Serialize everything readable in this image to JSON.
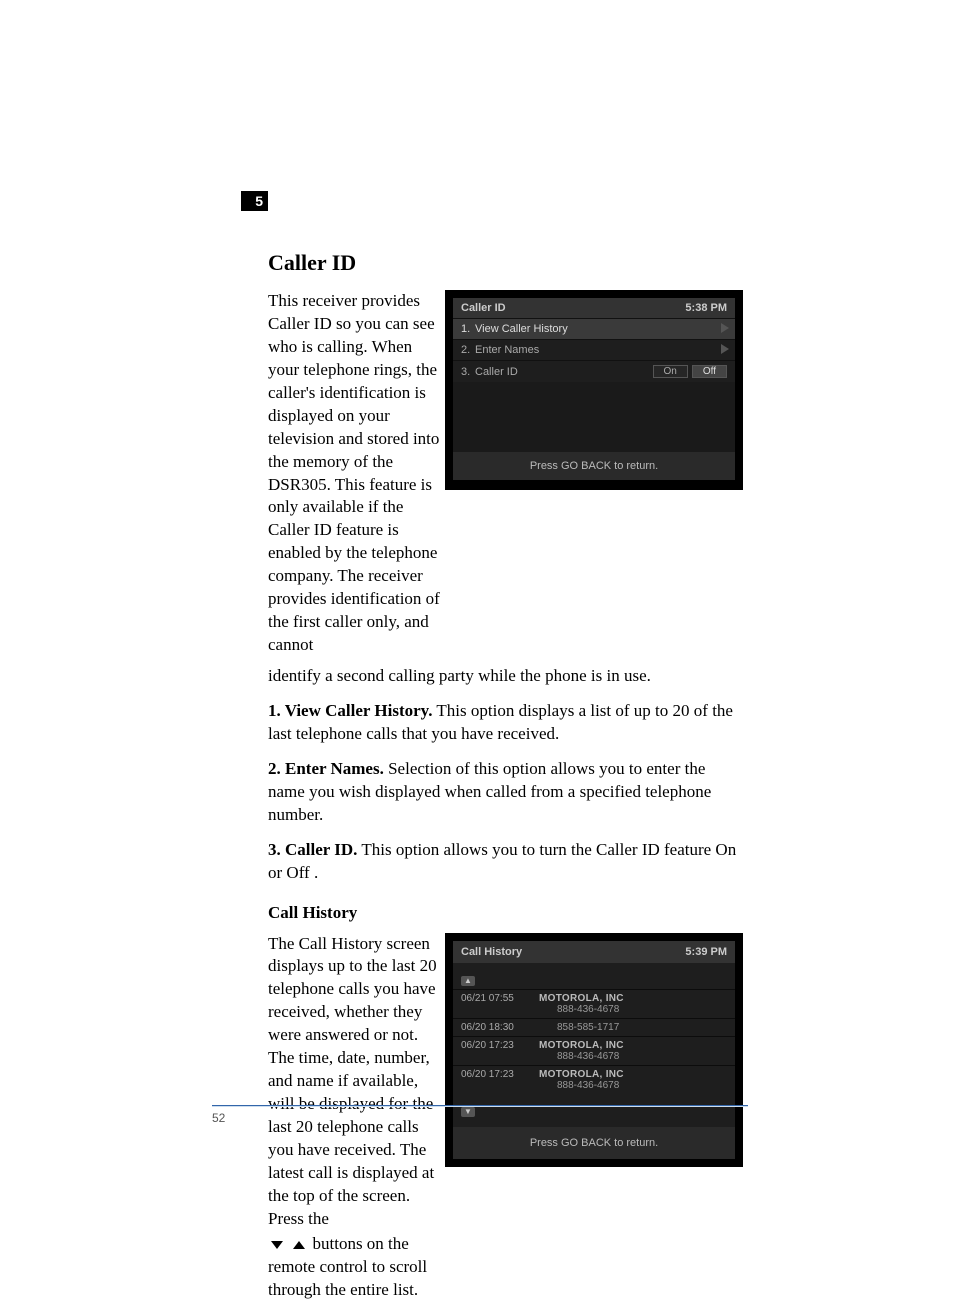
{
  "chapter": {
    "num": "5"
  },
  "h1": "Caller ID",
  "intro_a": "This receiver provides Caller ID so you can see who is calling. When your telephone rings, the caller's identification is displayed on your television and stored into the memory of the DSR305. This feature is only available if the Caller ID feature is enabled by the telephone company.  The receiver provides identification of the first caller only, and cannot",
  "intro_b": "identify a second calling party while the phone is in use.",
  "opt1_h": "1. View Caller History.",
  "opt1_t": " This option displays a list of up to 20 of the last telephone calls that you have received.",
  "opt2_h": "2. Enter Names.",
  "opt2_t": " Selection of this option allows you to enter the name you wish displayed when called from a specified telephone number.",
  "opt3_h": "3. Caller ID.",
  "opt3_t": " This option allows you to turn the Caller ID feature On or Off .",
  "h2": "Call History",
  "hist_a": "The Call History screen displays up to the last 20 telephone calls you have received, whether they were answered or not. The time, date, number, and name if available, will be displayed for the last 20 telephone calls you have received. The latest call is displayed at the top of the screen. Press the",
  "hist_b": " buttons on the remote control to scroll through the entire list.",
  "osd1": {
    "title": "Caller ID",
    "time": "5:38 PM",
    "r1": "View Caller History",
    "r2": "Enter Names",
    "r3": "Caller ID",
    "on": "On",
    "off": "Off",
    "back": "Press GO BACK to return."
  },
  "osd2": {
    "title": "Call History",
    "time": "5:39 PM",
    "rows": [
      {
        "dt": "06/21 07:55",
        "nm": "MOTOROLA, INC",
        "ph": "888-436-4678"
      },
      {
        "dt": "06/20 18:30",
        "nm": "",
        "ph": "858-585-1717"
      },
      {
        "dt": "06/20 17:23",
        "nm": "MOTOROLA, INC",
        "ph": "888-436-4678"
      },
      {
        "dt": "06/20 17:23",
        "nm": "MOTOROLA, INC",
        "ph": "888-436-4678"
      }
    ],
    "back": "Press GO BACK to return."
  },
  "page_num": "52"
}
